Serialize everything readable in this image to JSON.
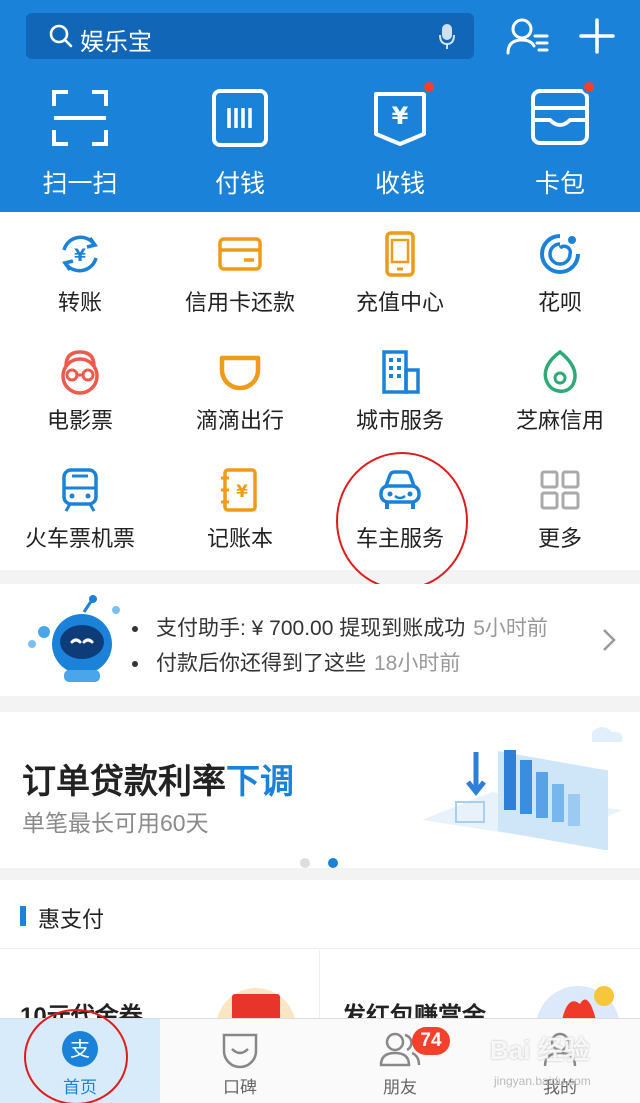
{
  "header": {
    "search_text": "娱乐宝",
    "quick_actions": [
      {
        "label": "扫一扫",
        "icon": "scan-icon"
      },
      {
        "label": "付钱",
        "icon": "barcode-pay-icon"
      },
      {
        "label": "收钱",
        "icon": "receive-money-icon"
      },
      {
        "label": "卡包",
        "icon": "card-wallet-icon"
      }
    ]
  },
  "grid": {
    "items": [
      {
        "label": "转账",
        "icon": "transfer-icon"
      },
      {
        "label": "信用卡还款",
        "icon": "credit-card-icon"
      },
      {
        "label": "充值中心",
        "icon": "phone-recharge-icon"
      },
      {
        "label": "花呗",
        "icon": "huabei-icon"
      },
      {
        "label": "电影票",
        "icon": "movie-ticket-icon"
      },
      {
        "label": "滴滴出行",
        "icon": "didi-icon"
      },
      {
        "label": "城市服务",
        "icon": "city-building-icon"
      },
      {
        "label": "芝麻信用",
        "icon": "sesame-credit-icon"
      },
      {
        "label": "火车票机票",
        "icon": "train-icon"
      },
      {
        "label": "记账本",
        "icon": "account-book-icon"
      },
      {
        "label": "车主服务",
        "icon": "car-icon"
      },
      {
        "label": "更多",
        "icon": "more-grid-icon"
      }
    ]
  },
  "notification": {
    "line1": "支付助手: ¥ 700.00 提现到账成功",
    "line1_time": "5小时前",
    "line2": "付款后你还得到了这些",
    "line2_time": "18小时前"
  },
  "banner": {
    "title_main": "订单贷款利率",
    "title_highlight": "下调",
    "subtitle": "单笔最长可用60天",
    "page_count": 2,
    "active_page": 2
  },
  "section": {
    "title": "惠支付",
    "card1_title": "10元代金券",
    "card2_title": "发红包赚赏金"
  },
  "tabbar": {
    "tabs": [
      {
        "label": "首页",
        "icon": "home-alipay-icon",
        "active": true
      },
      {
        "label": "口碑",
        "icon": "koubei-icon",
        "active": false
      },
      {
        "label": "朋友",
        "icon": "friends-icon",
        "active": false
      },
      {
        "label": "我的",
        "icon": "profile-icon",
        "active": false
      }
    ],
    "friends_badge": "74"
  },
  "watermark": {
    "text": "Bai 经验",
    "sub": "jingyan.baidu.com"
  },
  "colors": {
    "primary": "#1b82d9",
    "header_dark": "#1266b8",
    "badge_red": "#f5412b",
    "annotation_red": "#e11b1b"
  }
}
